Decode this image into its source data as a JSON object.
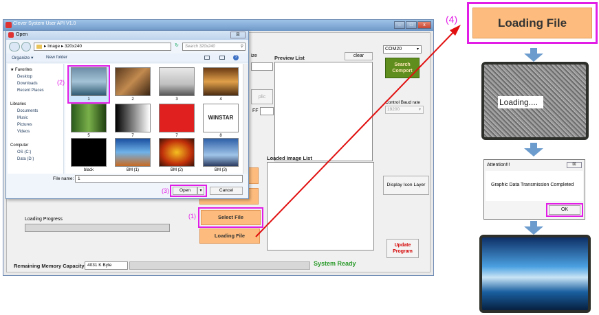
{
  "main_window": {
    "title": "Clever System User API V1.0",
    "controls": {
      "minimize": "–",
      "maximize": "□",
      "close": "x"
    },
    "preview_list_label": "Preview List",
    "clear_label": "clear",
    "loaded_image_list_label": "Loaded Image List",
    "com_port_value": "COM20",
    "search_comport_label": "Search Comport",
    "control_baud_rate_label": "Control Baud rate",
    "baud_rate_value": "19200",
    "display_icon_layer_label": "Display Icon Layer",
    "update_program_label": "Update Program",
    "select_file_label": "Select File",
    "loading_file_label": "Loading File",
    "loading_progress_label": "Loading Progress",
    "remaining_memory_label": "Remaining Memory Capacity",
    "remaining_memory_value": "4031 K Byte",
    "system_status": "System Ready",
    "partial_size_label": "ize",
    "partial_off_label": "FF",
    "partial_apply_label": "plic",
    "colors": {
      "green_status": "#2a9a2a",
      "update_red": "#d40000",
      "search_green": "#5f8e1e"
    }
  },
  "open_dialog": {
    "title": "Open",
    "breadcrumb": "▸ Image ▸ 320x240",
    "search_placeholder": "Search 320x240",
    "organize_label": "Organize ▾",
    "new_folder_label": "New folder",
    "nav": {
      "favorites": "Favorites",
      "desktop": "Desktop",
      "downloads": "Downloads",
      "recent": "Recent Places",
      "libraries": "Libraries",
      "documents": "Documents",
      "music": "Music",
      "pictures": "Pictures",
      "videos": "Videos",
      "computer": "Computer",
      "os_c": "OS (C:)",
      "data_d": "Data (D:)"
    },
    "files": [
      "1",
      "2",
      "3",
      "4",
      "5",
      "7",
      "7",
      "8",
      "black",
      "BM (1)",
      "BM (2)",
      "BM (3)"
    ],
    "winstar_text": "WINSTAR",
    "file_name_label": "File name:",
    "file_name_value": "1",
    "open_label": "Open",
    "cancel_label": "Cancel"
  },
  "step_labels": {
    "s1": "(1)",
    "s2": "(2)",
    "s3": "(3)",
    "s4": "(4)"
  },
  "right_panel": {
    "loading_file_label": "Loading File",
    "loading_overlay": "Loading....",
    "attention_title": "Attention!!!",
    "attention_message": "Graphic Data Transmission Completed",
    "ok_label": "OK",
    "close_x": "☒"
  }
}
